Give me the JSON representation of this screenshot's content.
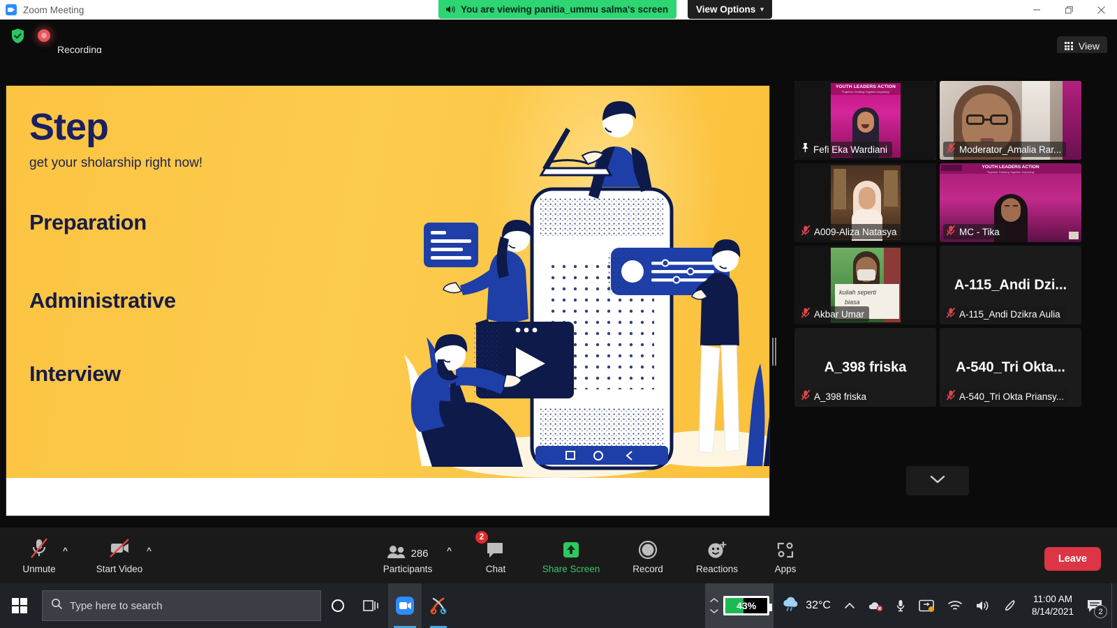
{
  "window": {
    "title": "Zoom Meeting",
    "app_icon": "zoom-video-icon",
    "minimize": "minimize-icon",
    "maximize": "restore-icon",
    "close": "close-icon"
  },
  "share_banner": {
    "text": "You are viewing panitia_ummu salma's screen",
    "speaker_icon": "speaker-icon",
    "view_options_label": "View Options",
    "chevron": "⌄",
    "bg_color": "#2ed573",
    "text_color": "#06261a"
  },
  "header": {
    "encryption_icon": "shield-check-icon",
    "recording_icon": "record-dot-icon",
    "recording_label": "Recording",
    "view_button_label": "View",
    "view_button_icon": "grid-icon"
  },
  "shared_slide": {
    "title": "Step",
    "subtitle": "get your sholarship right now!",
    "items": [
      "Preparation",
      "Administrative",
      "Interview"
    ],
    "bg_color": "#fcc442",
    "text_color": "#1b2060",
    "illustration": "people-with-phone-illustration"
  },
  "filmstrip": {
    "drag_handle": "panel-resize-handle",
    "scroll_down_icon": "chevron-down-icon",
    "participants": [
      {
        "name": "Fefi Eka Wardiani",
        "display": "label",
        "pinned": true,
        "muted": false,
        "active_speaker": true,
        "video": "virtual-background-pink"
      },
      {
        "name": "Moderator_Amalia Rar...",
        "display": "label",
        "pinned": false,
        "muted": true,
        "active_speaker": false,
        "video": "webcam-indoor"
      },
      {
        "name": "A009-Aliza Natasya",
        "display": "label",
        "pinned": false,
        "muted": true,
        "active_speaker": false,
        "video": "webcam-room"
      },
      {
        "name": "MC - Tika",
        "display": "label",
        "pinned": false,
        "muted": true,
        "active_speaker": false,
        "video": "virtual-background-pink"
      },
      {
        "name": "Akbar Umar",
        "display": "label",
        "pinned": false,
        "muted": true,
        "active_speaker": false,
        "video": "webcam-sign"
      },
      {
        "name": "A-115_Andi Dzikra Aulia",
        "center_name": "A-115_Andi  Dzi...",
        "display": "name-only",
        "pinned": false,
        "muted": true,
        "active_speaker": false,
        "video": "none"
      },
      {
        "name": "A_398 friska",
        "center_name": "A_398 friska",
        "display": "name-only",
        "pinned": false,
        "muted": true,
        "active_speaker": false,
        "video": "none"
      },
      {
        "name": "A-540_Tri Okta Priansy...",
        "center_name": "A-540_Tri  Okta...",
        "display": "name-only",
        "pinned": false,
        "muted": true,
        "active_speaker": false,
        "video": "none"
      }
    ]
  },
  "toolbar": {
    "mute": {
      "label": "Unmute",
      "icon": "microphone-muted-icon",
      "caret": "⌃"
    },
    "video": {
      "label": "Start Video",
      "icon": "camera-off-icon",
      "caret": "⌃"
    },
    "participants": {
      "label": "Participants",
      "icon": "participants-icon",
      "count": "286",
      "caret": "⌃"
    },
    "chat": {
      "label": "Chat",
      "icon": "chat-bubble-icon",
      "badge": "2"
    },
    "share": {
      "label": "Share Screen",
      "icon": "share-screen-icon",
      "color": "#3ac569"
    },
    "record": {
      "label": "Record",
      "icon": "record-circle-icon"
    },
    "reactions": {
      "label": "Reactions",
      "icon": "reactions-smiley-icon"
    },
    "apps": {
      "label": "Apps",
      "icon": "apps-icon"
    },
    "leave": {
      "label": "Leave",
      "color": "#dc3545"
    }
  },
  "taskbar": {
    "start_icon": "windows-start-icon",
    "search_placeholder": "Type here to search",
    "search_icon": "search-icon",
    "apps": [
      {
        "name": "cortana-icon"
      },
      {
        "name": "task-view-icon"
      },
      {
        "name": "zoom-taskbar-icon"
      },
      {
        "name": "snip-and-sketch-icon"
      }
    ],
    "battery": {
      "percent": "43%",
      "fill": 43,
      "color": "#1db954"
    },
    "weather": {
      "temperature": "32°C",
      "icon": "cloud-rain-icon"
    },
    "tray": [
      {
        "name": "show-hidden-icons-chevron"
      },
      {
        "name": "onedrive-error-icon"
      },
      {
        "name": "microphone-icon"
      },
      {
        "name": "display-switch-icon"
      },
      {
        "name": "wifi-icon"
      },
      {
        "name": "volume-icon"
      },
      {
        "name": "pen-icon"
      }
    ],
    "clock": {
      "time": "11:00 AM",
      "date": "8/14/2021"
    },
    "notifications": {
      "icon": "action-center-icon",
      "count": "2"
    }
  }
}
